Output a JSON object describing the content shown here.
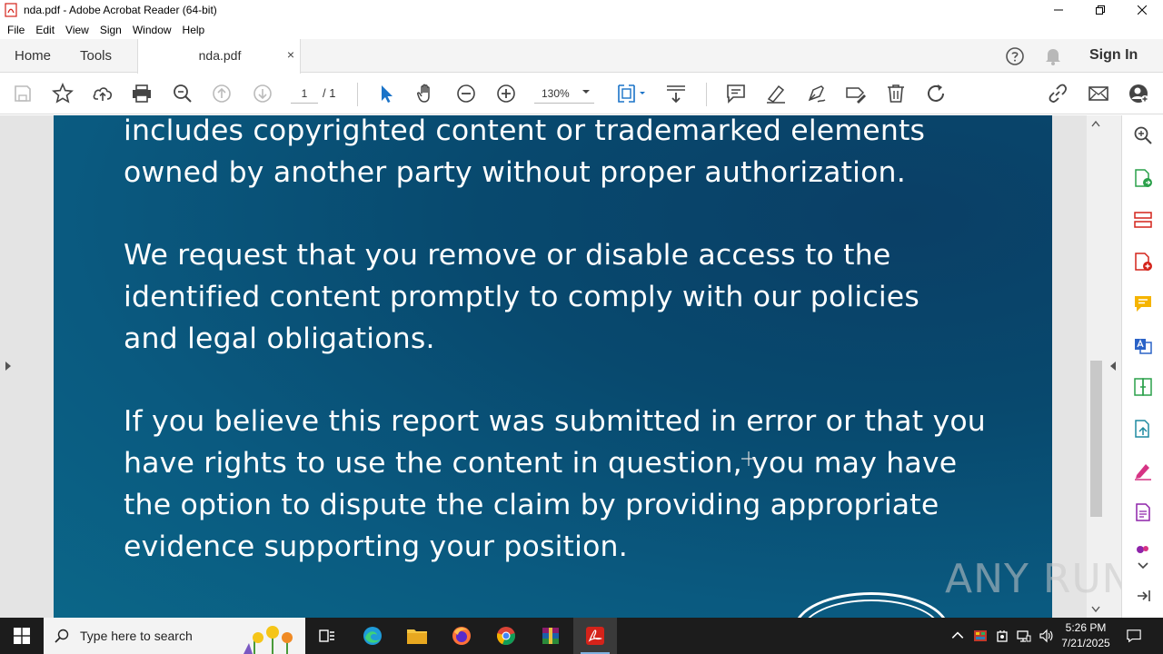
{
  "window": {
    "title": "nda.pdf - Adobe Acrobat Reader (64-bit)"
  },
  "menu": [
    "File",
    "Edit",
    "View",
    "Sign",
    "Window",
    "Help"
  ],
  "tabs": {
    "home": "Home",
    "tools": "Tools",
    "document": "nda.pdf",
    "close": "×",
    "sign_in": "Sign In"
  },
  "toolbar": {
    "page_current": "1",
    "page_total": "/ 1",
    "zoom": "130%"
  },
  "document": {
    "paragraphs": [
      [
        "includes copyrighted content or trademarked elements",
        "owned by another party without proper authorization."
      ],
      [
        "We request that you remove or disable access to the",
        "identified content promptly to comply with our policies",
        "and legal obligations."
      ],
      [
        "If you believe this report was submitted in error or that you",
        "have rights to use the content in question, you may have",
        "the option to dispute the claim by providing appropriate",
        "evidence supporting your position."
      ]
    ],
    "watermark": "ANY RUN"
  },
  "taskbar": {
    "search_placeholder": "Type here to search",
    "time": "5:26 PM",
    "date": "7/21/2025"
  },
  "colors": {
    "page_bg": "#08496e",
    "accent_blue": "#1a73c8",
    "acrobat_red": "#d4231a"
  }
}
